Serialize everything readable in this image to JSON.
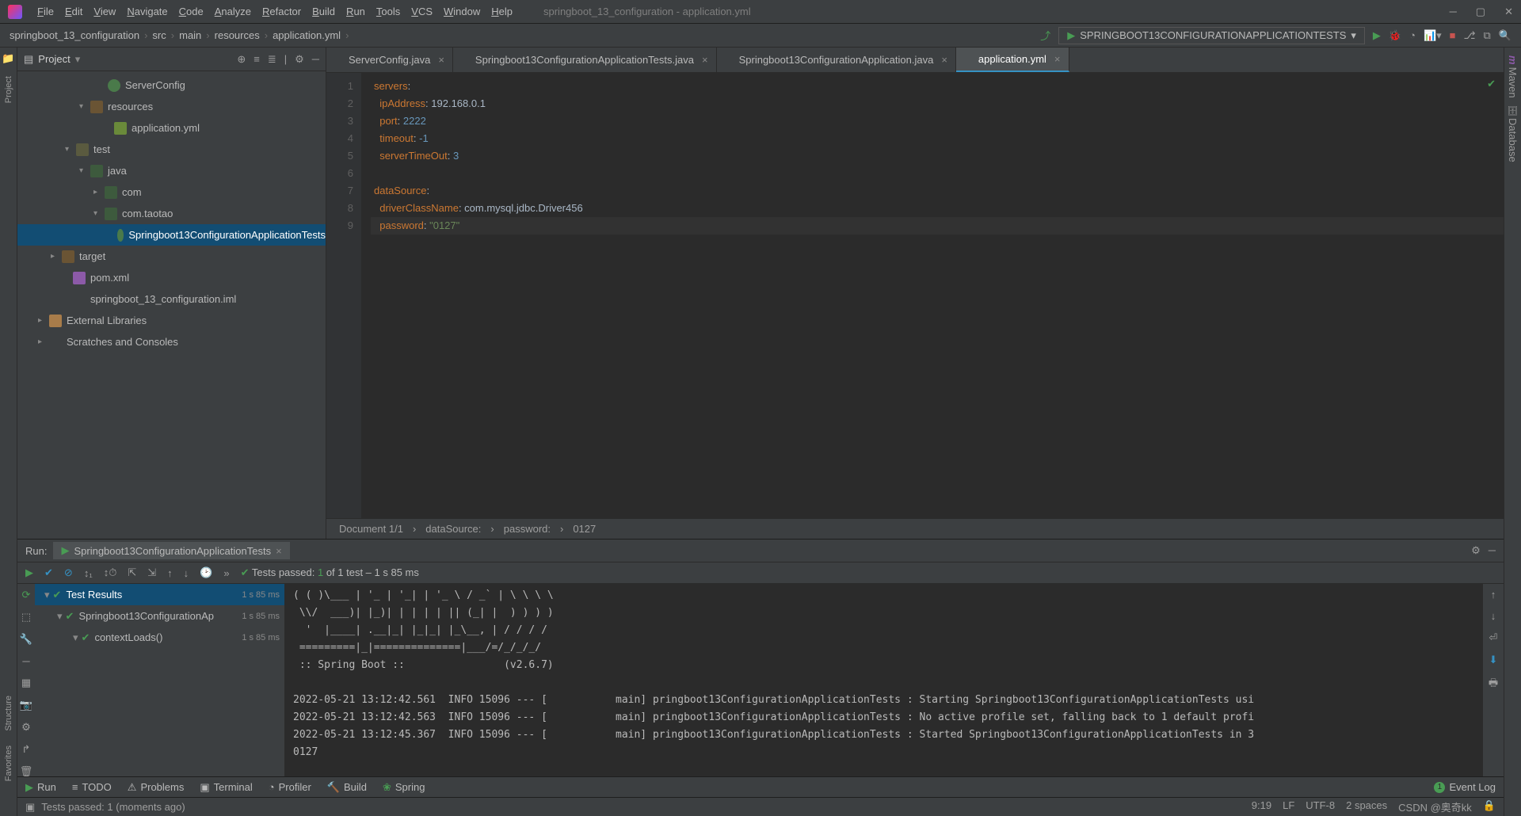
{
  "menu": {
    "items": [
      "File",
      "Edit",
      "View",
      "Navigate",
      "Code",
      "Analyze",
      "Refactor",
      "Build",
      "Run",
      "Tools",
      "VCS",
      "Window",
      "Help"
    ],
    "title": "springboot_13_configuration - application.yml"
  },
  "nav": {
    "crumbs": [
      "springboot_13_configuration",
      "src",
      "main",
      "resources",
      "application.yml"
    ],
    "runconf": "SPRINGBOOT13CONFIGURATIONAPPLICATIONTESTS"
  },
  "left_tabs": [
    "Project",
    "Structure",
    "Favorites"
  ],
  "right_tabs": [
    "Maven",
    "Database"
  ],
  "project": {
    "title": "Project",
    "tree": [
      {
        "pad": 100,
        "arrow": "",
        "icon": "cls",
        "label": "ServerConfig"
      },
      {
        "pad": 78,
        "arrow": "▾",
        "icon": "folder-r",
        "label": "resources"
      },
      {
        "pad": 108,
        "arrow": "",
        "icon": "yml",
        "label": "application.yml"
      },
      {
        "pad": 60,
        "arrow": "▾",
        "icon": "folder",
        "label": "test"
      },
      {
        "pad": 78,
        "arrow": "▾",
        "icon": "pkg",
        "label": "java"
      },
      {
        "pad": 96,
        "arrow": "▸",
        "icon": "pkg",
        "label": "com"
      },
      {
        "pad": 96,
        "arrow": "▾",
        "icon": "pkg",
        "label": "com.taotao"
      },
      {
        "pad": 118,
        "arrow": "",
        "icon": "cls",
        "label": "Springboot13ConfigurationApplicationTests",
        "sel": true
      },
      {
        "pad": 42,
        "arrow": "▸",
        "icon": "folder-r",
        "label": "target"
      },
      {
        "pad": 56,
        "arrow": "",
        "icon": "m",
        "label": "pom.xml"
      },
      {
        "pad": 56,
        "arrow": "",
        "icon": "file",
        "label": "springboot_13_configuration.iml"
      },
      {
        "pad": 26,
        "arrow": "▸",
        "icon": "lib",
        "label": "External Libraries"
      },
      {
        "pad": 26,
        "arrow": "▸",
        "icon": "file",
        "label": "Scratches and Consoles"
      }
    ]
  },
  "tabs": [
    {
      "label": "ServerConfig.java",
      "icon": "cls"
    },
    {
      "label": "Springboot13ConfigurationApplicationTests.java",
      "icon": "cls"
    },
    {
      "label": "Springboot13ConfigurationApplication.java",
      "icon": "cls"
    },
    {
      "label": "application.yml",
      "icon": "yml",
      "active": true
    }
  ],
  "code": {
    "lines": [
      {
        "n": "1",
        "h": "<span class='k'>servers</span>:"
      },
      {
        "n": "2",
        "h": "  <span class='k'>ipAddress</span>: 192.168.0.1"
      },
      {
        "n": "3",
        "h": "  <span class='k'>port</span>: <span class='n'>2222</span>"
      },
      {
        "n": "4",
        "h": "  <span class='k'>timeout</span>: <span class='n'>-1</span>"
      },
      {
        "n": "5",
        "h": "  <span class='k'>serverTimeOut</span>: <span class='n'>3</span>"
      },
      {
        "n": "6",
        "h": ""
      },
      {
        "n": "7",
        "h": "<span class='k'>dataSource</span>:"
      },
      {
        "n": "8",
        "h": "  <span class='k'>driverClassName</span>: com.mysql.jdbc.Driver456"
      },
      {
        "n": "9",
        "h": "  <span class='k'>password</span>: <span class='s'>\"0127\"</span>",
        "hl": true
      }
    ]
  },
  "crumbbar": {
    "doc": "Document 1/1",
    "items": [
      "dataSource:",
      "password:",
      "0127"
    ]
  },
  "run": {
    "label": "Run:",
    "tab": "Springboot13ConfigurationApplicationTests",
    "status": {
      "pre": "Tests passed: ",
      "passed": "1",
      "of": " of 1 test – 1 s 85 ms"
    },
    "tree": [
      {
        "pad": 6,
        "label": "Test Results",
        "tm": "1 s 85 ms",
        "sel": true
      },
      {
        "pad": 22,
        "label": "Springboot13ConfigurationAp",
        "tm": "1 s 85 ms"
      },
      {
        "pad": 42,
        "label": "contextLoads()",
        "tm": "1 s 85 ms"
      }
    ],
    "console": "( ( )\\___ | '_ | '_| | '_ \\ / _` | \\ \\ \\ \\\n \\\\/  ___)| |_)| | | | | || (_| |  ) ) ) )\n  '  |____| .__|_| |_|_| |_\\__, | / / / /\n =========|_|==============|___/=/_/_/_/\n :: Spring Boot ::                (v2.6.7)\n\n2022-05-21 13:12:42.561  INFO 15096 --- [           main] pringboot13ConfigurationApplicationTests : Starting Springboot13ConfigurationApplicationTests usi\n2022-05-21 13:12:42.563  INFO 15096 --- [           main] pringboot13ConfigurationApplicationTests : No active profile set, falling back to 1 default profi\n2022-05-21 13:12:45.367  INFO 15096 --- [           main] pringboot13ConfigurationApplicationTests : Started Springboot13ConfigurationApplicationTests in 3\n0127"
  },
  "bottom": {
    "tabs": [
      "Run",
      "TODO",
      "Problems",
      "Terminal",
      "Profiler",
      "Build",
      "Spring"
    ],
    "event": "Event Log"
  },
  "status": {
    "msg": "Tests passed: 1 (moments ago)",
    "pos": "9:19",
    "lf": "LF",
    "enc": "UTF-8",
    "sp": "2 spaces",
    "wm": "CSDN @奥奇kk"
  }
}
